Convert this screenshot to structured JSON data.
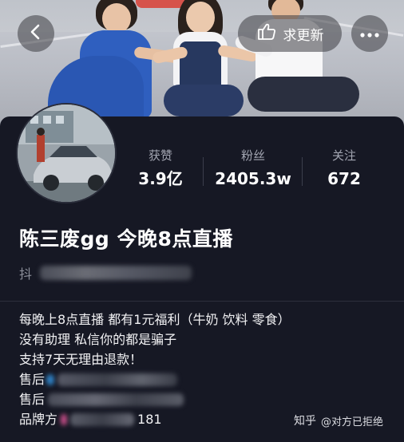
{
  "header": {
    "update_label": "求更新"
  },
  "profile": {
    "name": "陈三废gg 今晚8点直播",
    "douyin_id_prefix": "抖"
  },
  "stats": [
    {
      "key": "获赞",
      "value": "3.9亿"
    },
    {
      "key": "粉丝",
      "value": "2405.3w"
    },
    {
      "key": "关注",
      "value": "672"
    }
  ],
  "bio": [
    "每晚上8点直播 都有1元福利（牛奶 饮料 零食）",
    "没有助理 私信你的都是骗子",
    "支持7天无理由退款！",
    "售后",
    "售后",
    "品牌方"
  ],
  "bio_suffix": "181",
  "watermark": {
    "site": "知乎",
    "author": "@对方已拒绝"
  },
  "icons": [
    "back-arrow-icon",
    "update-hand-icon",
    "more-dots-icon"
  ],
  "colors": {
    "background": "#161824",
    "text": "#ffffff",
    "muted": "#a3a6b2"
  }
}
